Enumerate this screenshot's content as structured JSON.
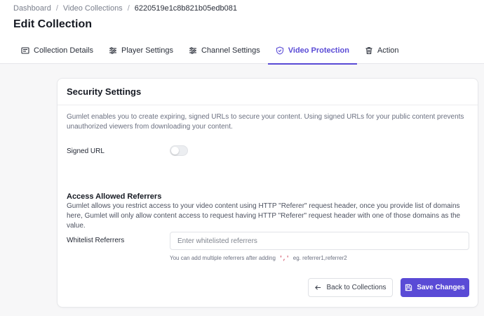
{
  "breadcrumb": {
    "items": [
      "Dashboard",
      "Video Collections",
      "6220519e1c8b821b05edb081"
    ],
    "separator": "/"
  },
  "page": {
    "title": "Edit Collection"
  },
  "tabs": [
    {
      "label": "Collection Details",
      "icon": "list-icon",
      "active": false
    },
    {
      "label": "Player Settings",
      "icon": "sliders-icon",
      "active": false
    },
    {
      "label": "Channel Settings",
      "icon": "sliders-icon",
      "active": false
    },
    {
      "label": "Video Protection",
      "icon": "shield-icon",
      "active": true
    },
    {
      "label": "Action",
      "icon": "trash-icon",
      "active": false
    }
  ],
  "card": {
    "title": "Security Settings",
    "description": "Gumlet enables you to create expiring, signed URLs to secure your content. Using signed URLs for your public content prevents unauthorized viewers from downloading your content.",
    "signed_url": {
      "label": "Signed URL",
      "enabled": false
    },
    "referrers": {
      "title": "Access Allowed Referrers",
      "description": "Gumlet allows you restrict access to your video content using HTTP \"Referer\" request header, once you provide list of domains here, Gumlet will only allow content access to request having HTTP \"Referer\" request header with one of those domains as the value.",
      "label": "Whitelist Referrers",
      "value": "",
      "placeholder": "Enter whitelisted referrers",
      "hint_prefix": "You can add multiple referrers after adding",
      "hint_code": "','",
      "hint_suffix": "eg. referrer1,referrer2"
    },
    "buttons": {
      "back": "Back to Collections",
      "save": "Save Changes"
    }
  },
  "colors": {
    "accent": "#5a4bd6",
    "background": "#f7f7f8"
  }
}
